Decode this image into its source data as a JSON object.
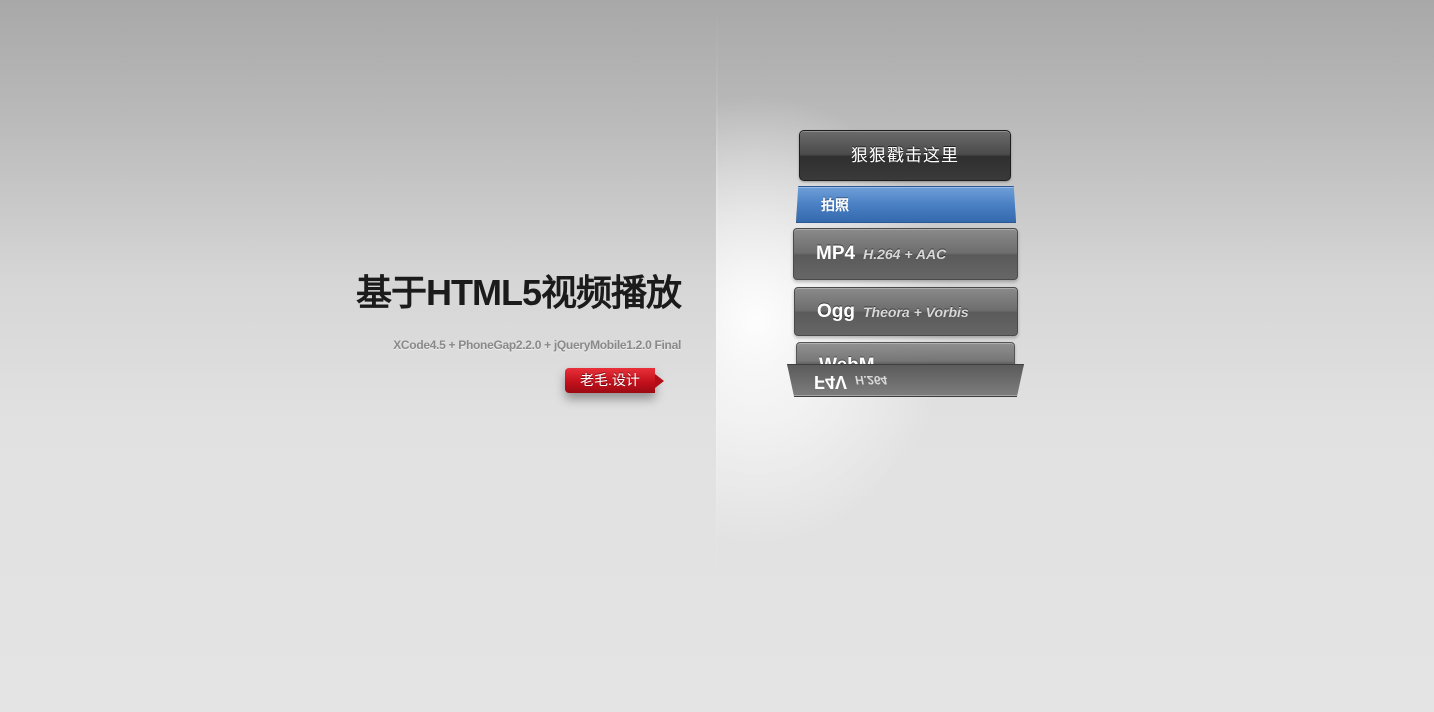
{
  "header": {
    "title": "基于HTML5视频播放",
    "subtitle": "XCode4.5 + PhoneGap2.2.0 + jQueryMobile1.2.0 Final",
    "author_tag": "老毛.设计"
  },
  "menu": {
    "main_button": "狠狠戳击这里",
    "photo_button": "拍照",
    "formats": [
      {
        "name": "MP4",
        "codec": "H.264 + AAC"
      },
      {
        "name": "Ogg",
        "codec": "Theora + Vorbis"
      },
      {
        "name": "WebM",
        "codec": ""
      }
    ],
    "flipped_card": {
      "name": "F4V",
      "codec": "H.264"
    }
  },
  "colors": {
    "accent_blue": "#4a80c4",
    "tag_red": "#c4111c",
    "dark_button": "#3a3a3a"
  }
}
